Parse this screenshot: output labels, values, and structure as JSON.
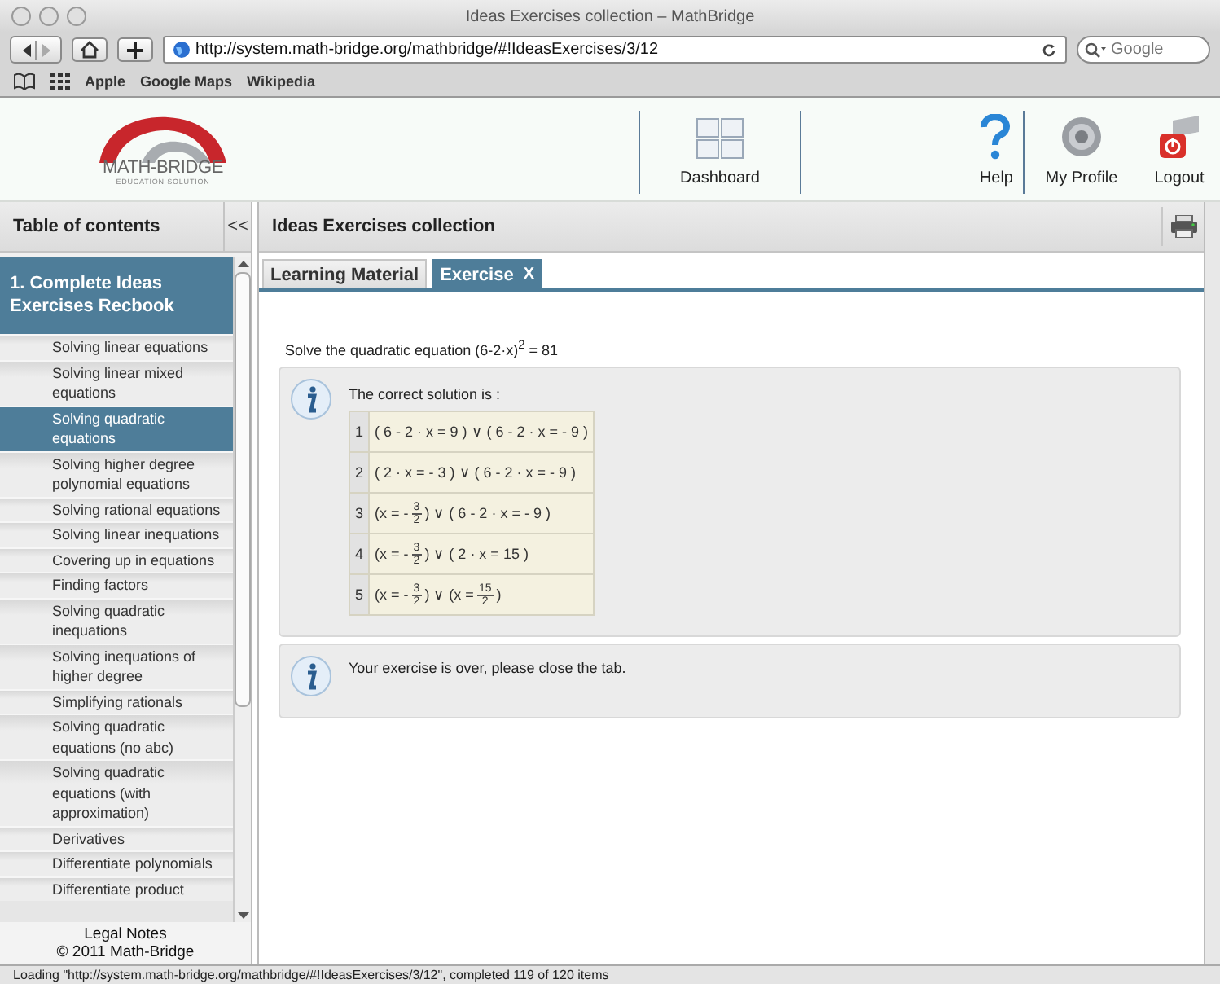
{
  "window": {
    "title": "Ideas Exercises collection – MathBridge"
  },
  "browser": {
    "url": "http://system.math-bridge.org/mathbridge/#!IdeasExercises/3/12",
    "search_placeholder": "Google",
    "bookmarks": [
      "Apple",
      "Google Maps",
      "Wikipedia"
    ]
  },
  "header": {
    "logo": {
      "name": "MATH-BRIDGE",
      "tagline": "EDUCATION SOLUTION"
    },
    "nav": [
      {
        "kind": "dashboard",
        "label": "Dashboard"
      },
      {
        "kind": "help",
        "label": "Help"
      },
      {
        "kind": "profile",
        "label": "My Profile"
      },
      {
        "kind": "logout",
        "label": "Logout"
      }
    ]
  },
  "sidebar": {
    "title": "Table of contents",
    "collapse": "<<",
    "chapter": "1. Complete Ideas Exercises Recbook",
    "items": [
      {
        "label": "Solving linear equations",
        "selected": false
      },
      {
        "label": "Solving linear mixed equations",
        "selected": false
      },
      {
        "label": "Solving quadratic equations",
        "selected": true
      },
      {
        "label": "Solving higher degree polynomial equations",
        "selected": false
      },
      {
        "label": "Solving rational equations",
        "selected": false
      },
      {
        "label": "Solving linear inequations",
        "selected": false
      },
      {
        "label": "Covering up in equations",
        "selected": false
      },
      {
        "label": "Finding factors",
        "selected": false
      },
      {
        "label": "Solving quadratic inequations",
        "selected": false
      },
      {
        "label": "Solving inequations of higher degree",
        "selected": false
      },
      {
        "label": "Simplifying rationals",
        "selected": false
      },
      {
        "label": "Solving quadratic equations (no abc)",
        "selected": false
      },
      {
        "label": "Solving quadratic equations (with approximation)",
        "selected": false
      },
      {
        "label": "Derivatives",
        "selected": false
      },
      {
        "label": "Differentiate polynomials",
        "selected": false
      },
      {
        "label": "Differentiate product",
        "selected": false
      }
    ],
    "footer": [
      "Legal Notes",
      "© 2011 Math-Bridge"
    ]
  },
  "main": {
    "title": "Ideas Exercises collection",
    "tabs": [
      {
        "label": "Learning Material",
        "selected": false
      },
      {
        "label": "Exercise",
        "selected": true,
        "close": "X"
      }
    ],
    "question": "Solve the quadratic equation (6-2·x)$^{2}$ = 81",
    "solution": {
      "text": "The correct solution is :",
      "steps": [
        {
          "number": "1",
          "parts": [
            {
              "kind": "text",
              "text": "( 6 - 2 · x = 9 ) ∨ ( 6 - 2 · x = - 9 )"
            }
          ]
        },
        {
          "number": "2",
          "parts": [
            {
              "kind": "text",
              "text": "( 2 · x = - 3 ) ∨ ( 6 - 2 · x = - 9 )"
            }
          ]
        },
        {
          "number": "3",
          "parts": [
            {
              "kind": "text",
              "text": "(x = -"
            },
            {
              "kind": "frac",
              "num": "3",
              "den": "2"
            },
            {
              "kind": "text",
              "text": ") ∨ ( 6 - 2 · x = - 9 )"
            }
          ]
        },
        {
          "number": "4",
          "parts": [
            {
              "kind": "text",
              "text": "(x = -"
            },
            {
              "kind": "frac",
              "num": "3",
              "den": "2"
            },
            {
              "kind": "text",
              "text": ") ∨ ( 2 · x = 15 )"
            }
          ]
        },
        {
          "number": "5",
          "parts": [
            {
              "kind": "text",
              "text": "(x = -"
            },
            {
              "kind": "frac",
              "num": "3",
              "den": "2"
            },
            {
              "kind": "text",
              "text": ") ∨ (x ="
            },
            {
              "kind": "frac",
              "num": "15",
              "den": "2"
            },
            {
              "kind": "text",
              "text": ")"
            }
          ]
        }
      ]
    },
    "notice": "Your exercise is over, please close the tab."
  },
  "status_bar": "Loading \"http://system.math-bridge.org/mathbridge/#!IdeasExercises/3/12\", completed 119 of 120 items"
}
